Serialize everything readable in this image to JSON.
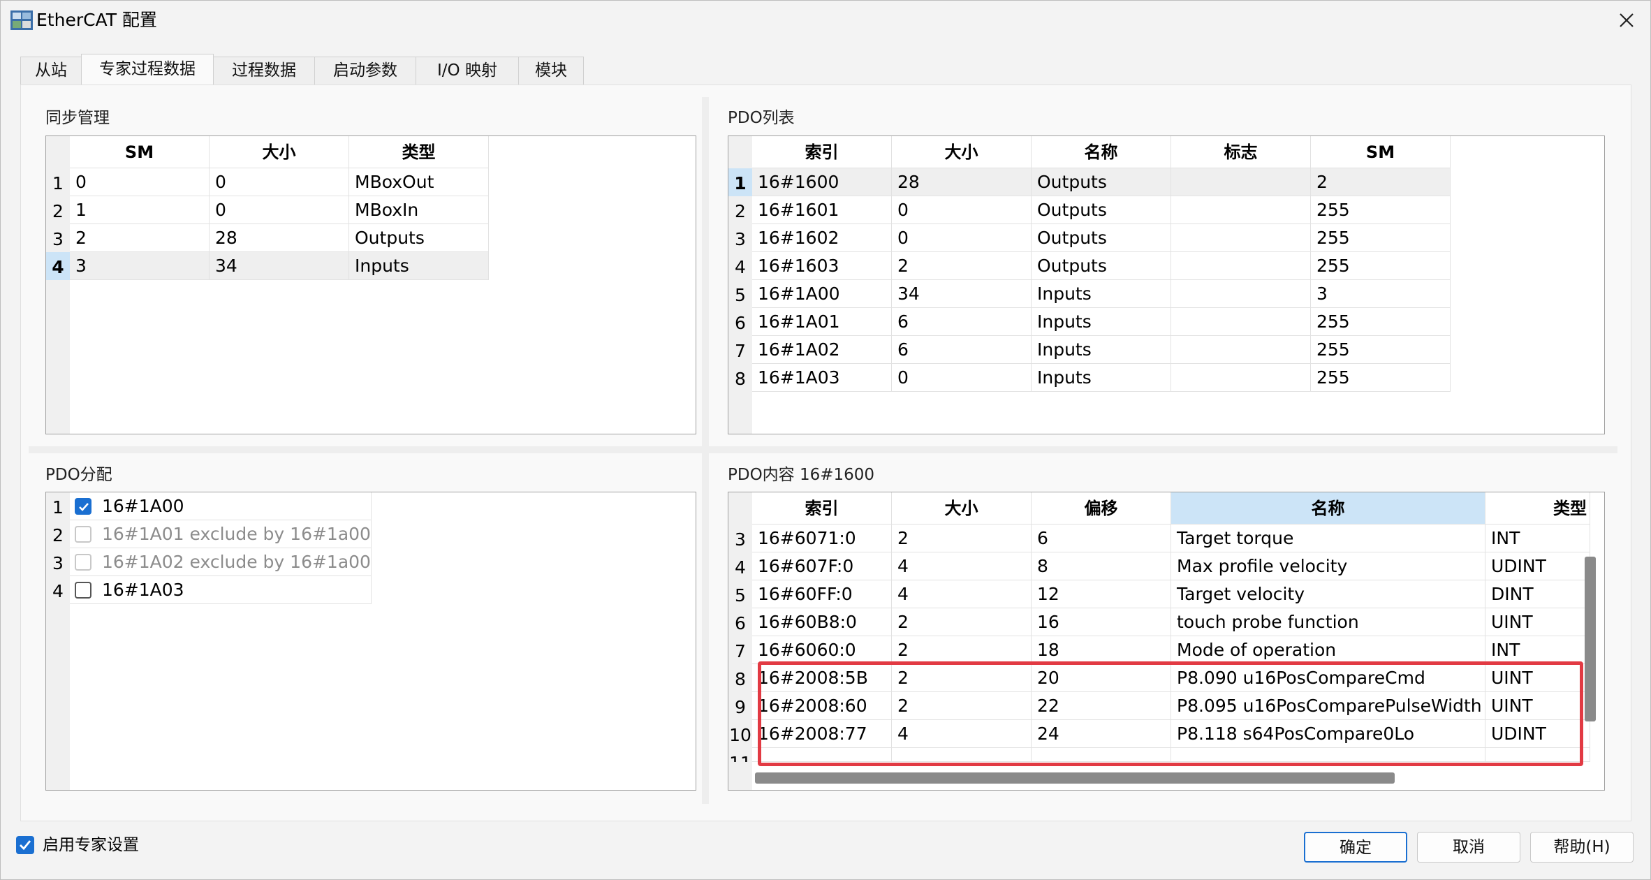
{
  "window": {
    "title": "EtherCAT 配置"
  },
  "tabs": [
    "从站",
    "专家过程数据",
    "过程数据",
    "启动参数",
    "I/O 映射",
    "模块"
  ],
  "sync_manager": {
    "title": "同步管理",
    "columns": [
      "SM",
      "大小",
      "类型"
    ],
    "rows": [
      {
        "num": "1",
        "sm": "0",
        "size": "0",
        "type": "MBoxOut"
      },
      {
        "num": "2",
        "sm": "1",
        "size": "0",
        "type": "MBoxIn"
      },
      {
        "num": "3",
        "sm": "2",
        "size": "28",
        "type": "Outputs"
      },
      {
        "num": "4",
        "sm": "3",
        "size": "34",
        "type": "Inputs"
      }
    ]
  },
  "pdo_list": {
    "title": "PDO列表",
    "columns": [
      "索引",
      "大小",
      "名称",
      "标志",
      "SM"
    ],
    "rows": [
      {
        "num": "1",
        "index": "16#1600",
        "size": "28",
        "name": "Outputs",
        "flags": "",
        "sm": "2"
      },
      {
        "num": "2",
        "index": "16#1601",
        "size": "0",
        "name": "Outputs",
        "flags": "",
        "sm": "255"
      },
      {
        "num": "3",
        "index": "16#1602",
        "size": "0",
        "name": "Outputs",
        "flags": "",
        "sm": "255"
      },
      {
        "num": "4",
        "index": "16#1603",
        "size": "2",
        "name": "Outputs",
        "flags": "",
        "sm": "255"
      },
      {
        "num": "5",
        "index": "16#1A00",
        "size": "34",
        "name": "Inputs",
        "flags": "",
        "sm": "3"
      },
      {
        "num": "6",
        "index": "16#1A01",
        "size": "6",
        "name": "Inputs",
        "flags": "",
        "sm": "255"
      },
      {
        "num": "7",
        "index": "16#1A02",
        "size": "6",
        "name": "Inputs",
        "flags": "",
        "sm": "255"
      },
      {
        "num": "8",
        "index": "16#1A03",
        "size": "0",
        "name": "Inputs",
        "flags": "",
        "sm": "255"
      }
    ]
  },
  "pdo_assign": {
    "title": "PDO分配",
    "rows": [
      {
        "num": "1",
        "label": "16#1A00",
        "checked": true,
        "disabled": false
      },
      {
        "num": "2",
        "label": "16#1A01   exclude by 16#1a00",
        "checked": false,
        "disabled": true
      },
      {
        "num": "3",
        "label": "16#1A02   exclude by 16#1a00",
        "checked": false,
        "disabled": true
      },
      {
        "num": "4",
        "label": "16#1A03",
        "checked": false,
        "disabled": false
      }
    ]
  },
  "pdo_content": {
    "title": "PDO内容  16#1600",
    "columns": [
      "索引",
      "大小",
      "偏移",
      "名称",
      "类型"
    ],
    "rows": [
      {
        "num": "3",
        "index": "16#6071:0",
        "size": "2",
        "offset": "6",
        "name": "Target torque",
        "type": "INT"
      },
      {
        "num": "4",
        "index": "16#607F:0",
        "size": "4",
        "offset": "8",
        "name": "Max profile velocity",
        "type": "UDINT"
      },
      {
        "num": "5",
        "index": "16#60FF:0",
        "size": "4",
        "offset": "12",
        "name": "Target velocity",
        "type": "DINT"
      },
      {
        "num": "6",
        "index": "16#60B8:0",
        "size": "2",
        "offset": "16",
        "name": "touch probe function",
        "type": "UINT"
      },
      {
        "num": "7",
        "index": "16#6060:0",
        "size": "2",
        "offset": "18",
        "name": "Mode of operation",
        "type": "INT"
      },
      {
        "num": "8",
        "index": "16#2008:5B",
        "size": "2",
        "offset": "20",
        "name": "P8.090 u16PosCompareCmd",
        "type": "UINT"
      },
      {
        "num": "9",
        "index": "16#2008:60",
        "size": "2",
        "offset": "22",
        "name": "P8.095 u16PosComparePulseWidth",
        "type": "UINT"
      },
      {
        "num": "10",
        "index": "16#2008:77",
        "size": "4",
        "offset": "24",
        "name": "P8.118 s64PosCompare0Lo",
        "type": "UDINT"
      },
      {
        "num": "11",
        "index": "",
        "size": "",
        "offset": "",
        "name": "",
        "type": ""
      }
    ]
  },
  "footer": {
    "expert_label": "启用专家设置",
    "ok": "确定",
    "cancel": "取消",
    "help": "帮助(H)"
  },
  "colors": {
    "accent": "#1a6fd1",
    "highlight": "#e23a43",
    "selected_header": "#cce4f7"
  }
}
